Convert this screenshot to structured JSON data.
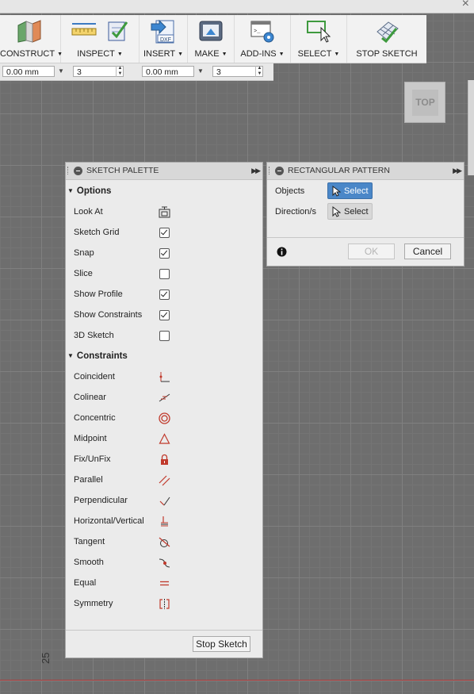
{
  "window": {
    "close_glyph": "×"
  },
  "toolbar": {
    "groups": [
      {
        "label": "CONSTRUCT",
        "icon": "construct-plane-icon"
      },
      {
        "label": "INSPECT",
        "icon": "measure-icon"
      },
      {
        "label": "INSERT",
        "icon": "insert-dxf-icon"
      },
      {
        "label": "MAKE",
        "icon": "3d-print-icon"
      },
      {
        "label": "ADD-INS",
        "icon": "scripts-addins-icon"
      },
      {
        "label": "SELECT",
        "icon": "select-window-icon"
      },
      {
        "label": "STOP SKETCH",
        "icon": "stop-sketch-icon"
      }
    ],
    "dxf_text": "DXF",
    "caret": "▼"
  },
  "inputs": [
    {
      "value": "0.00 mm"
    },
    {
      "value": "3"
    },
    {
      "value": "0.00 mm"
    },
    {
      "value": "3"
    }
  ],
  "viewcube": {
    "face": "TOP"
  },
  "sketch_palette": {
    "title": "SKETCH PALETTE",
    "options_heading": "Options",
    "options": [
      {
        "label": "Look At",
        "control": "look-at-icon"
      },
      {
        "label": "Sketch Grid",
        "checked": true
      },
      {
        "label": "Snap",
        "checked": true
      },
      {
        "label": "Slice",
        "checked": false
      },
      {
        "label": "Show Profile",
        "checked": true
      },
      {
        "label": "Show Constraints",
        "checked": true
      },
      {
        "label": "3D Sketch",
        "checked": false
      }
    ],
    "constraints_heading": "Constraints",
    "constraints": [
      {
        "label": "Coincident",
        "icon": "coincident-icon"
      },
      {
        "label": "Colinear",
        "icon": "colinear-icon"
      },
      {
        "label": "Concentric",
        "icon": "concentric-icon"
      },
      {
        "label": "Midpoint",
        "icon": "midpoint-icon"
      },
      {
        "label": "Fix/UnFix",
        "icon": "fix-lock-icon"
      },
      {
        "label": "Parallel",
        "icon": "parallel-icon"
      },
      {
        "label": "Perpendicular",
        "icon": "perpendicular-icon"
      },
      {
        "label": "Horizontal/Vertical",
        "icon": "horizontal-vertical-icon"
      },
      {
        "label": "Tangent",
        "icon": "tangent-icon"
      },
      {
        "label": "Smooth",
        "icon": "smooth-icon"
      },
      {
        "label": "Equal",
        "icon": "equal-icon"
      },
      {
        "label": "Symmetry",
        "icon": "symmetry-icon"
      }
    ],
    "stop_button": "Stop Sketch"
  },
  "rect_pattern": {
    "title": "RECTANGULAR PATTERN",
    "objects_label": "Objects",
    "objects_button": "Select",
    "direction_label": "Direction/s",
    "direction_button": "Select",
    "ok": "OK",
    "cancel": "Cancel"
  },
  "canvas": {
    "axis_number": "25",
    "accent_red": "#b13a3a",
    "select_blue": "#4a87c8",
    "icon_red": "#c0392b"
  }
}
